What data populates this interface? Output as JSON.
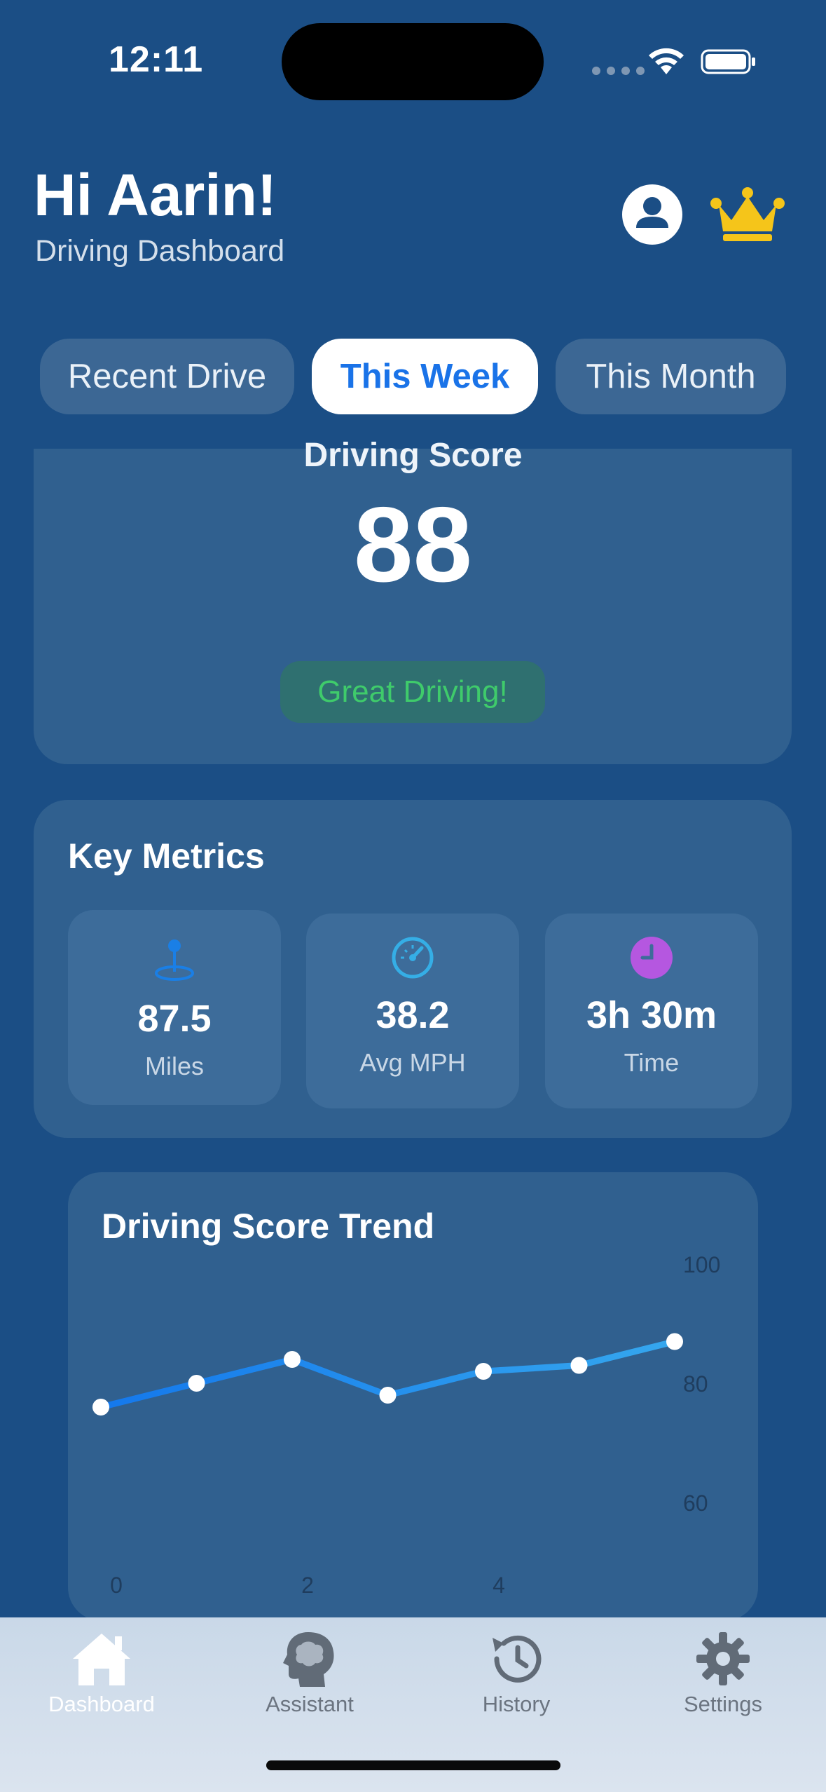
{
  "status_bar": {
    "time": "12:11"
  },
  "header": {
    "greeting": "Hi Aarin!",
    "subtitle": "Driving Dashboard",
    "profile_icon": "person-circle-icon",
    "premium_icon": "crown-icon"
  },
  "period_tabs": [
    {
      "label": "Recent Drive",
      "active": false
    },
    {
      "label": "This Week",
      "active": true
    },
    {
      "label": "This Month",
      "active": false
    }
  ],
  "score": {
    "label": "Driving Score",
    "value": "88",
    "badge": "Great Driving!"
  },
  "metrics": {
    "title": "Key Metrics",
    "items": [
      {
        "icon": "map-pin-icon",
        "value": "87.5",
        "label": "Miles",
        "color": "#1a7fe6"
      },
      {
        "icon": "speedometer-icon",
        "value": "38.2",
        "label": "Avg MPH",
        "color": "#35aee6"
      },
      {
        "icon": "clock-icon",
        "value": "3h 30m",
        "label": "Time",
        "color": "#b557e0"
      }
    ]
  },
  "trend": {
    "title": "Driving Score Trend",
    "chart_data": {
      "type": "line",
      "x": [
        0,
        1,
        2,
        3,
        4,
        5,
        6
      ],
      "series": [
        {
          "values": [
            76,
            80,
            84,
            78,
            82,
            83,
            87
          ]
        }
      ],
      "xticks": [
        "0",
        "2",
        "4"
      ],
      "yticks": [
        "100",
        "80",
        "60"
      ],
      "ylim": [
        60,
        100
      ],
      "line_color": "#1a86f0",
      "grid": false
    }
  },
  "tab_bar": [
    {
      "icon": "house-icon",
      "label": "Dashboard",
      "active": true
    },
    {
      "icon": "brain-head-icon",
      "label": "Assistant",
      "active": false
    },
    {
      "icon": "history-icon",
      "label": "History",
      "active": false
    },
    {
      "icon": "gear-icon",
      "label": "Settings",
      "active": false
    }
  ]
}
